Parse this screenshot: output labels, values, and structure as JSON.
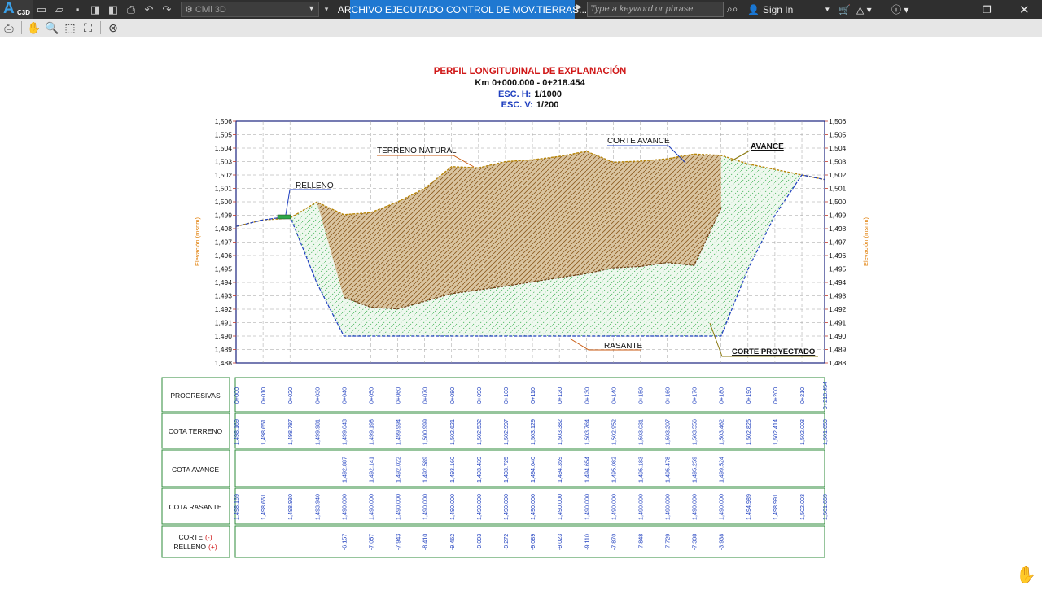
{
  "app": {
    "logo_letter": "A",
    "logo_sub": "C3D",
    "workspace": "Civil 3D",
    "document_title": "ARCHIVO EJECUTADO CONTROL DE MOV.TIERRAS...",
    "search_placeholder": "Type a keyword or phrase",
    "sign_in": "Sign In"
  },
  "drawing": {
    "title": "PERFIL LONGITUDINAL DE EXPLANACIÓN",
    "km_range": "Km 0+000.000 - 0+218.454",
    "esc_h_label": "ESC. H:",
    "esc_h_value": "1/1000",
    "esc_v_label": "ESC. V:",
    "esc_v_value": "1/200",
    "axis_label": "Elevación (msnm)",
    "elevation_ticks": [
      "1,506",
      "1,505",
      "1,504",
      "1,503",
      "1,502",
      "1,501",
      "1,500",
      "1,499",
      "1,498",
      "1,497",
      "1,496",
      "1,495",
      "1,494",
      "1,493",
      "1,492",
      "1,491",
      "1,490",
      "1,489",
      "1,488"
    ],
    "labels": {
      "terreno_natural": "TERRENO NATURAL",
      "corte_avance": "CORTE AVANCE",
      "avance": "AVANCE",
      "relleno": "RELLENO",
      "rasante": "RASANTE",
      "corte_proyectado": "CORTE PROYECTADO"
    },
    "colors": {
      "terrain": "#b8860b",
      "rasante": "#1f3fbf",
      "fill_projected": "#2fa84a",
      "fill_avance": "#8b5a1e",
      "frame": "#1a237e",
      "grid": "#9e9e9e",
      "table_border": "#2e8b3a",
      "title_red": "#d01818"
    }
  },
  "chart_data": {
    "type": "line",
    "x": [
      0,
      10,
      20,
      30,
      40,
      50,
      60,
      70,
      80,
      90,
      100,
      110,
      120,
      130,
      140,
      150,
      160,
      170,
      180,
      190,
      200,
      210,
      218.454
    ],
    "ylim": [
      1488,
      1506
    ],
    "series": [
      {
        "name": "TERRENO NATURAL",
        "values": [
          1498.169,
          1498.651,
          1498.787,
          1499.981,
          1499.043,
          1499.198,
          1499.994,
          1500.999,
          1502.621,
          1502.532,
          1502.997,
          1503.129,
          1503.382,
          1503.764,
          1502.952,
          1503.031,
          1503.207,
          1503.556,
          1503.462,
          1502.825,
          1502.414,
          1502.003,
          1501.659
        ]
      },
      {
        "name": "COTA AVANCE",
        "values": [
          null,
          null,
          null,
          null,
          1492.887,
          1492.141,
          1492.022,
          1492.589,
          1493.16,
          1493.439,
          1493.725,
          1494.04,
          1494.359,
          1494.654,
          1495.082,
          1495.183,
          1495.478,
          1495.259,
          1499.524,
          null,
          null,
          null,
          null
        ]
      },
      {
        "name": "RASANTE",
        "values": [
          1498.169,
          1498.651,
          1498.93,
          1493.94,
          1490.0,
          1490.0,
          1490.0,
          1490.0,
          1490.0,
          1490.0,
          1490.0,
          1490.0,
          1490.0,
          1490.0,
          1490.0,
          1490.0,
          1490.0,
          1490.0,
          1490.0,
          1494.989,
          1498.991,
          1502.003,
          1501.659
        ]
      }
    ]
  },
  "table": {
    "headers": {
      "progresivas": "PROGRESIVAS",
      "cota_terreno": "COTA TERRENO",
      "cota_avance": "COTA AVANCE",
      "cota_rasante": "COTA RASANTE",
      "corte": "CORTE",
      "corte_sign": "(-)",
      "relleno": "RELLENO",
      "relleno_sign": "(+)"
    },
    "progresivas": [
      "0+000",
      "0+010",
      "0+020",
      "0+030",
      "0+040",
      "0+050",
      "0+060",
      "0+070",
      "0+080",
      "0+090",
      "0+100",
      "0+110",
      "0+120",
      "0+130",
      "0+140",
      "0+150",
      "0+160",
      "0+170",
      "0+180",
      "0+190",
      "0+200",
      "0+210",
      "0+218.454"
    ],
    "cota_terreno": [
      "1,498.169",
      "1,498.651",
      "1,498.787",
      "1,499.981",
      "1,499.043",
      "1,499.198",
      "1,499.994",
      "1,500.999",
      "1,502.621",
      "1,502.532",
      "1,502.997",
      "1,503.129",
      "1,503.382",
      "1,503.764",
      "1,502.952",
      "1,503.031",
      "1,503.207",
      "1,503.556",
      "1,503.462",
      "1,502.825",
      "1,502.414",
      "1,502.003",
      "1,501.659"
    ],
    "cota_avance": [
      "",
      "",
      "",
      "",
      "1,492.887",
      "1,492.141",
      "1,492.022",
      "1,492.589",
      "1,493.160",
      "1,493.439",
      "1,493.725",
      "1,494.040",
      "1,494.359",
      "1,494.654",
      "1,495.082",
      "1,495.183",
      "1,495.478",
      "1,495.259",
      "1,499.524",
      "",
      "",
      "",
      ""
    ],
    "cota_rasante": [
      "1,498.169",
      "1,498.651",
      "1,498.930",
      "1,493.940",
      "1,490.000",
      "1,490.000",
      "1,490.000",
      "1,490.000",
      "1,490.000",
      "1,490.000",
      "1,490.000",
      "1,490.000",
      "1,490.000",
      "1,490.000",
      "1,490.000",
      "1,490.000",
      "1,490.000",
      "1,490.000",
      "1,490.000",
      "1,494.989",
      "1,498.991",
      "1,502.003",
      "1,501.659"
    ],
    "corte_relleno": [
      "",
      "",
      "",
      "",
      "-6.157",
      "-7.057",
      "-7.943",
      "-8.410",
      "-9.462",
      "-9.093",
      "-9.272",
      "-9.089",
      "-9.023",
      "-9.110",
      "-7.870",
      "-7.848",
      "-7.729",
      "-7.308",
      "-3.938",
      "",
      "",
      "",
      ""
    ]
  }
}
